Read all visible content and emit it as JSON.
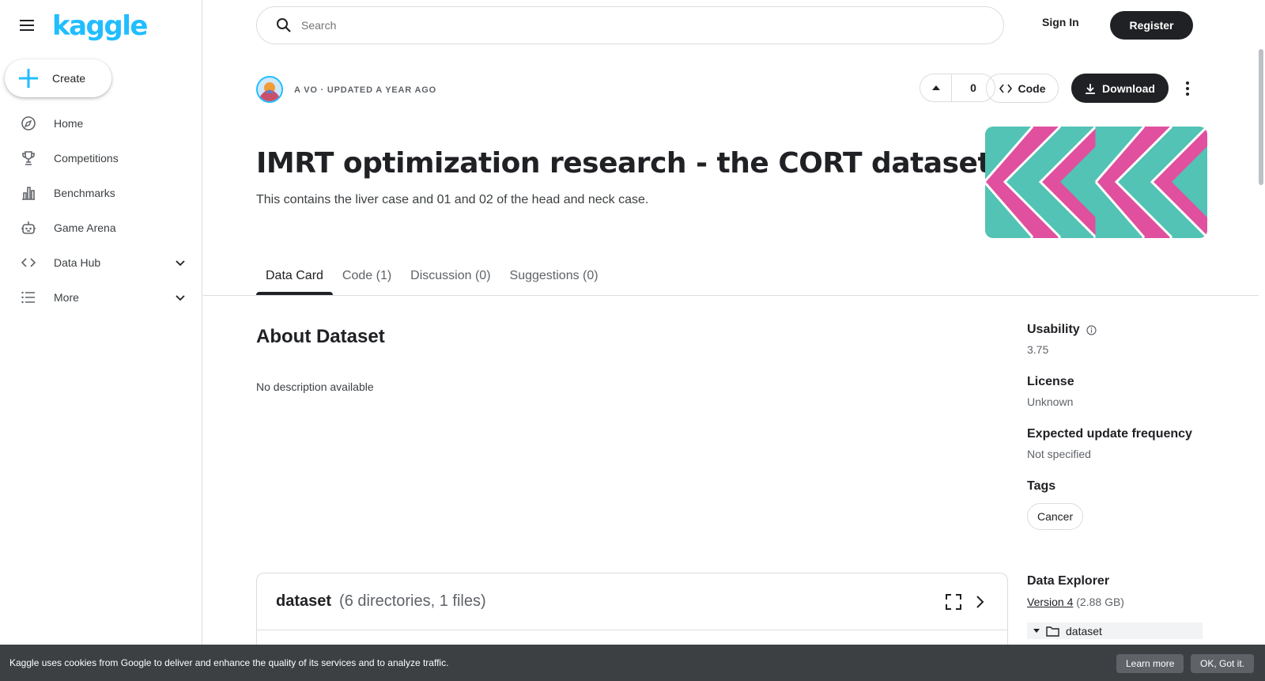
{
  "sidebar": {
    "logo": "kaggle",
    "create_label": "Create",
    "items": [
      {
        "label": "Home",
        "icon": "compass-icon"
      },
      {
        "label": "Competitions",
        "icon": "trophy-icon"
      },
      {
        "label": "Benchmarks",
        "icon": "bar-chart-icon"
      },
      {
        "label": "Game Arena",
        "icon": "robot-icon"
      },
      {
        "label": "Data Hub",
        "icon": "code-brackets-icon"
      },
      {
        "label": "More",
        "icon": "list-icon"
      }
    ]
  },
  "topbar": {
    "search_placeholder": "Search",
    "signin_label": "Sign In",
    "register_label": "Register"
  },
  "header": {
    "author_line": "A VO · UPDATED A YEAR AGO",
    "vote_count": "0",
    "code_label": "Code",
    "download_label": "Download",
    "title": "IMRT optimization research - the CORT dataset",
    "subtitle": "This contains the liver case and 01 and 02 of the head and neck case."
  },
  "tabs": [
    {
      "label": "Data Card",
      "active": true
    },
    {
      "label": "Code (1)",
      "active": false
    },
    {
      "label": "Discussion (0)",
      "active": false
    },
    {
      "label": "Suggestions (0)",
      "active": false
    }
  ],
  "about": {
    "heading": "About Dataset",
    "body": "No description available"
  },
  "details": {
    "usability_label": "Usability",
    "usability_value": "3.75",
    "license_label": "License",
    "license_value": "Unknown",
    "frequency_label": "Expected update frequency",
    "frequency_value": "Not specified",
    "tags_label": "Tags",
    "tag": "Cancer"
  },
  "data_explorer": {
    "title": "Data Explorer",
    "version_label": "Version 4",
    "size": "(2.88 GB)",
    "tree_root": "dataset"
  },
  "dataset_card": {
    "name": "dataset",
    "meta": "(6 directories, 1 files)"
  },
  "cookie": {
    "text": "Kaggle uses cookies from Google to deliver and enhance the quality of its services and to analyze traffic.",
    "learn_more": "Learn more",
    "ok": "OK, Got it."
  },
  "colors": {
    "brand": "#20beff",
    "primary_dark": "#202124",
    "cover_pink": "#e0509f",
    "cover_teal": "#52c3b4"
  }
}
